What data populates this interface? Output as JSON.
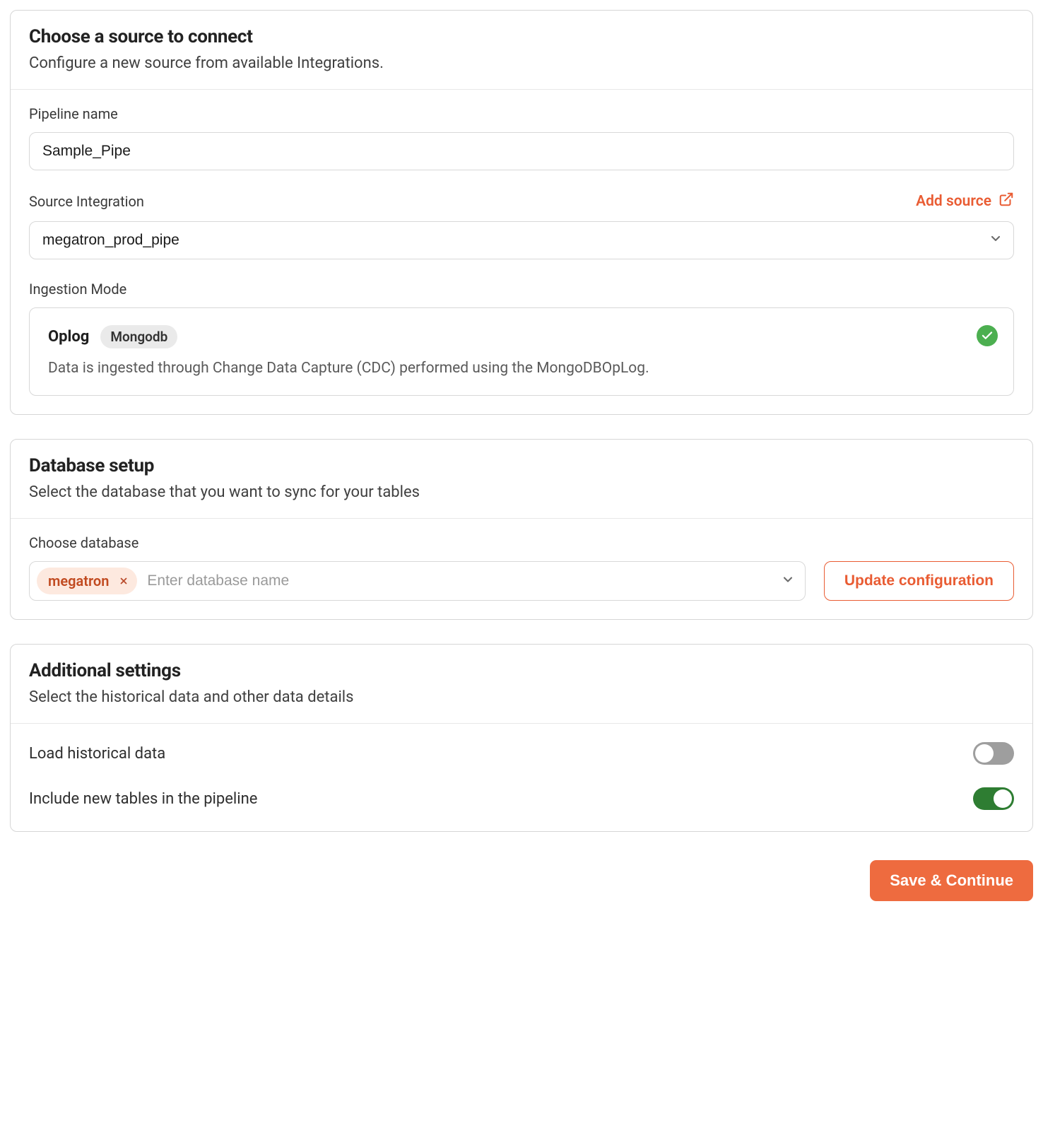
{
  "source": {
    "title": "Choose a source to connect",
    "desc": "Configure a new source from available Integrations.",
    "pipeline_name_label": "Pipeline name",
    "pipeline_name_value": "Sample_Pipe",
    "source_integration_label": "Source Integration",
    "add_source_label": "Add source",
    "source_integration_value": "megatron_prod_pipe",
    "ingestion_mode_label": "Ingestion Mode",
    "mode_name": "Oplog",
    "mode_badge": "Mongodb",
    "mode_desc": "Data is ingested through Change Data Capture (CDC) performed using the MongoDBOpLog."
  },
  "database": {
    "title": "Database setup",
    "desc": "Select the database that you want to sync for your tables",
    "choose_label": "Choose database",
    "chip_value": "megatron",
    "input_placeholder": "Enter database name",
    "update_button": "Update configuration"
  },
  "additional": {
    "title": "Additional settings",
    "desc": "Select the historical data and other data details",
    "load_historical_label": "Load historical data",
    "load_historical_on": false,
    "include_new_label": "Include new tables in the pipeline",
    "include_new_on": true
  },
  "footer": {
    "save_label": "Save & Continue"
  }
}
